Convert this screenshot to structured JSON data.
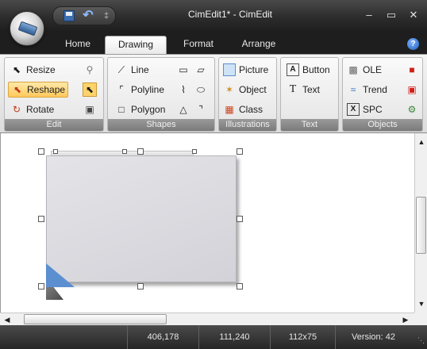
{
  "window": {
    "title": "CimEdit1* - CimEdit",
    "minimize_glyph": "–",
    "maximize_glyph": "▭",
    "close_glyph": "✕"
  },
  "quick_access": {
    "icons": [
      "save-icon",
      "undo-icon"
    ],
    "separator": "‡"
  },
  "tabs": [
    {
      "label": "Home",
      "active": false
    },
    {
      "label": "Drawing",
      "active": true
    },
    {
      "label": "Format",
      "active": false
    },
    {
      "label": "Arrange",
      "active": false
    }
  ],
  "help_glyph": "?",
  "ribbon": {
    "edit": {
      "label": "Edit",
      "commands": [
        {
          "label": "Resize",
          "icon": "resize-arrow-icon",
          "selected": false
        },
        {
          "label": "Reshape",
          "icon": "reshape-arrow-icon",
          "selected": true
        },
        {
          "label": "Rotate",
          "icon": "rotate-arrow-icon",
          "selected": false
        }
      ],
      "mini_icons": [
        "zoom-icon",
        "pointer-icon",
        "lock-icon"
      ]
    },
    "shapes": {
      "label": "Shapes",
      "commands": [
        {
          "label": "Line",
          "icon": "line-icon"
        },
        {
          "label": "Polyline",
          "icon": "polyline-icon"
        },
        {
          "label": "Polygon",
          "icon": "polygon-icon"
        }
      ],
      "mini_icons": [
        "rectangle-icon",
        "parallelogram-icon",
        "arc-icon",
        "ellipse-icon",
        "chord-icon",
        "pipe-icon"
      ]
    },
    "illustrations": {
      "label": "Illustrations",
      "commands": [
        {
          "label": "Picture",
          "icon": "picture-icon"
        },
        {
          "label": "Object",
          "icon": "object-icon"
        },
        {
          "label": "Class",
          "icon": "class-icon"
        }
      ]
    },
    "text": {
      "label": "Text",
      "commands": [
        {
          "label": "Button",
          "icon": "button-icon"
        },
        {
          "label": "Text",
          "icon": "text-icon"
        }
      ]
    },
    "objects": {
      "label": "Objects",
      "commands": [
        {
          "label": "OLE",
          "icon": "ole-icon"
        },
        {
          "label": "Trend",
          "icon": "trend-icon"
        },
        {
          "label": "SPC",
          "icon": "spc-icon"
        }
      ],
      "mini_icons": [
        "activex-icon",
        "puzzle-icon",
        "gauge-icon"
      ]
    }
  },
  "statusbar": {
    "cells": [
      "",
      "406,178",
      "111,240",
      "112x75",
      "Version: 42"
    ]
  },
  "colors": {
    "accent": "#5b8fd0",
    "selected_command": "#ffc95c",
    "titlebar": "#2c2c2c"
  }
}
